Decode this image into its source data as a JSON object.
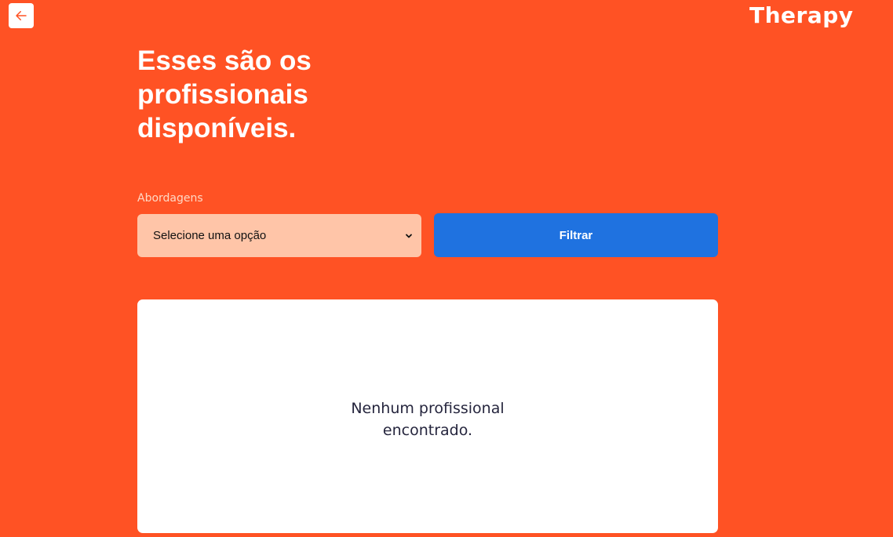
{
  "header": {
    "back_icon": "arrow-left-icon",
    "brand": "Therapy"
  },
  "main": {
    "title": "Esses são os profissionais disponíveis.",
    "filter": {
      "label": "Abordagens",
      "select_value": "Selecione uma opção",
      "chevron_icon": "chevron-down-icon",
      "button_label": "Filtrar"
    },
    "results": {
      "empty_message": "Nenhum profissional encontrado."
    }
  },
  "colors": {
    "background": "#ff5224",
    "select_background": "#ffc5a8",
    "button_background": "#1f72e0",
    "panel_background": "#ffffff",
    "message_text": "#25253d"
  }
}
